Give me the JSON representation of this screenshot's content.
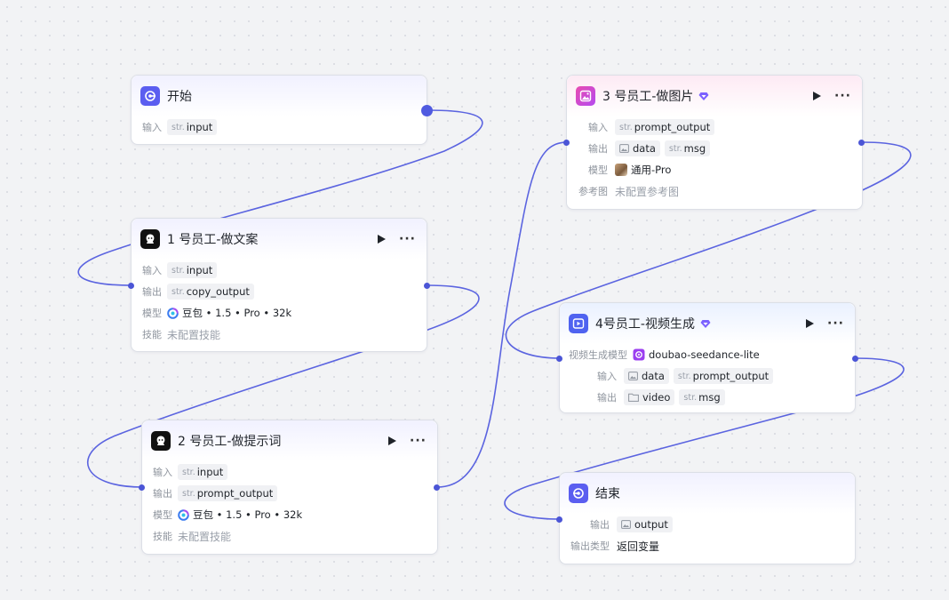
{
  "colors": {
    "edge": "#5b64e0",
    "port": "#4b55d6",
    "accent": "#5b5ef0"
  },
  "nodes": {
    "start": {
      "title": "开始",
      "icon": "start-icon",
      "rows": {
        "input_label": "输入",
        "input_type": "str.",
        "input_name": "input"
      }
    },
    "copywriter": {
      "title": "1 号员工-做文案",
      "icon": "robot-icon",
      "rows": {
        "input_label": "输入",
        "input_type": "str.",
        "input_name": "input",
        "output_label": "输出",
        "output_type": "str.",
        "output_name": "copy_output",
        "model_label": "模型",
        "model_value": "豆包 • 1.5 • Pro • 32k",
        "skill_label": "技能",
        "skill_value": "未配置技能"
      }
    },
    "prompt_writer": {
      "title": "2 号员工-做提示词",
      "icon": "robot-icon",
      "rows": {
        "input_label": "输入",
        "input_type": "str.",
        "input_name": "input",
        "output_label": "输出",
        "output_type": "str.",
        "output_name": "prompt_output",
        "model_label": "模型",
        "model_value": "豆包 • 1.5 • Pro • 32k",
        "skill_label": "技能",
        "skill_value": "未配置技能"
      }
    },
    "image_maker": {
      "title": "3 号员工-做图片",
      "icon": "image-gen-icon",
      "rows": {
        "input_label": "输入",
        "input_type": "str.",
        "input_name": "prompt_output",
        "output_label": "输出",
        "output_name_1": "data",
        "output_type_2": "str.",
        "output_name_2": "msg",
        "model_label": "模型",
        "model_value": "通用-Pro",
        "ref_label": "参考图",
        "ref_value": "未配置参考图"
      }
    },
    "video_maker": {
      "title": "4号员工-视频生成",
      "icon": "video-gen-icon",
      "rows": {
        "model_label": "视频生成模型",
        "model_value": "doubao-seedance-lite",
        "input_label": "输入",
        "input_name_1": "data",
        "input_type_2": "str.",
        "input_name_2": "prompt_output",
        "output_label": "输出",
        "output_name_1": "video",
        "output_type_2": "str.",
        "output_name_2": "msg"
      }
    },
    "end": {
      "title": "结束",
      "icon": "end-icon",
      "rows": {
        "output_label": "输出",
        "output_name": "output",
        "output_type_label": "输出类型",
        "output_type_value": "返回变量"
      }
    }
  }
}
